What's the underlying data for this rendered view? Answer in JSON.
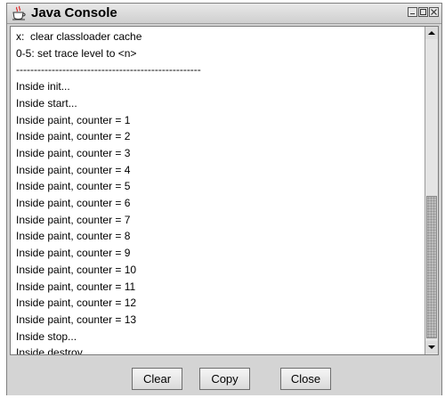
{
  "window": {
    "title": "Java Console"
  },
  "console": {
    "lines": [
      "x:  clear classloader cache",
      "0-5: set trace level to <n>",
      "----------------------------------------------------",
      "Inside init...",
      "Inside start...",
      "Inside paint, counter = 1",
      "Inside paint, counter = 2",
      "Inside paint, counter = 3",
      "Inside paint, counter = 4",
      "Inside paint, counter = 5",
      "Inside paint, counter = 6",
      "Inside paint, counter = 7",
      "Inside paint, counter = 8",
      "Inside paint, counter = 9",
      "Inside paint, counter = 10",
      "Inside paint, counter = 11",
      "Inside paint, counter = 12",
      "Inside paint, counter = 13",
      "Inside stop...",
      "Inside destroy..."
    ]
  },
  "buttons": {
    "clear": "Clear",
    "copy": "Copy",
    "close": "Close"
  },
  "icons": {
    "app": "java-cup-icon",
    "minimize": "minimize-icon",
    "maximize": "maximize-icon",
    "close": "close-icon",
    "scroll_up": "arrow-up-icon",
    "scroll_down": "arrow-down-icon"
  }
}
